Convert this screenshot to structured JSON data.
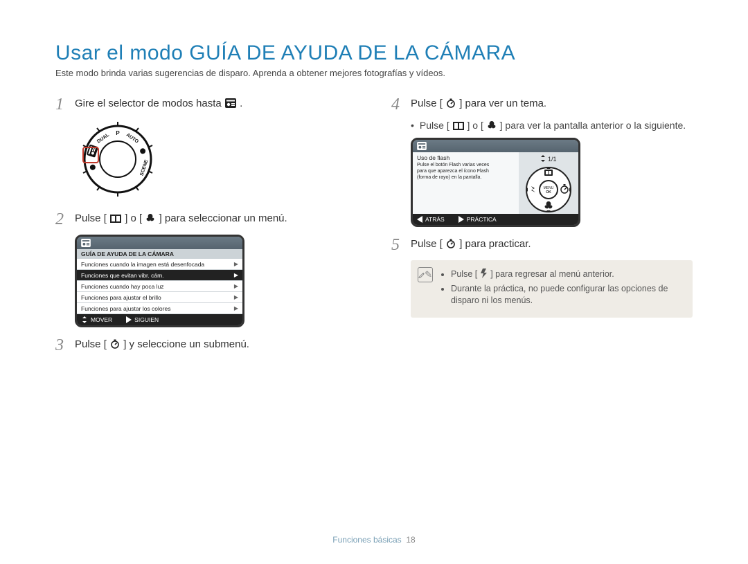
{
  "title": "Usar el modo GUÍA DE AYUDA DE LA CÁMARA",
  "subtitle": "Este modo brinda varias sugerencias de disparo. Aprenda a obtener mejores fotografías y vídeos.",
  "steps": {
    "s1": {
      "num": "1",
      "text_a": "Gire el selector de modos hasta ",
      "text_b": "."
    },
    "s2": {
      "num": "2",
      "text_a": "Pulse [",
      "text_mid": "] o [",
      "text_b": "] para seleccionar un menú."
    },
    "s3": {
      "num": "3",
      "text": "Pulse [",
      "text_b": "] y seleccione un submenú."
    },
    "s4": {
      "num": "4",
      "text": "Pulse [",
      "text_b": "] para ver un tema."
    },
    "s4_bullet": {
      "a": "Pulse [",
      "mid": "] o [",
      "b": "] para ver la pantalla anterior o la siguiente."
    },
    "s5": {
      "num": "5",
      "text": "Pulse [",
      "text_b": "] para practicar."
    }
  },
  "screen1": {
    "title": "GUÍA DE AYUDA DE LA CÁMARA",
    "rows": [
      "Funciones cuando la imagen está desenfocada",
      "Funciones que evitan vibr. cám.",
      "Funciones cuando hay poca luz",
      "Funciones para ajustar el brillo",
      "Funciones para ajustar los colores"
    ],
    "selected_index": 1,
    "foot_left": "MOVER",
    "foot_right": "SIGUIEN"
  },
  "screen2": {
    "page": "1/1",
    "detail_title": "Uso de flash",
    "detail_l1": "Pulse el botón Flash varias veces",
    "detail_l2": "para que aparezca el ícono Flash",
    "detail_l3": "(forma de rayo) en la pantalla.",
    "foot_left": "ATRÁS",
    "foot_right": "PRÁCTICA"
  },
  "note": {
    "b1_a": "Pulse [",
    "b1_b": "] para regresar al menú anterior.",
    "b2": "Durante la práctica, no puede configurar las opciones de disparo ni los menús."
  },
  "footer": {
    "section": "Funciones básicas",
    "page": "18"
  },
  "icons": {
    "guide_mode": "guide-mode-icon",
    "display": "display-icon",
    "macro": "macro-icon",
    "timer": "timer-icon",
    "flash": "flash-icon",
    "updown": "updown-icon",
    "left": "left-icon",
    "right": "right-icon"
  }
}
